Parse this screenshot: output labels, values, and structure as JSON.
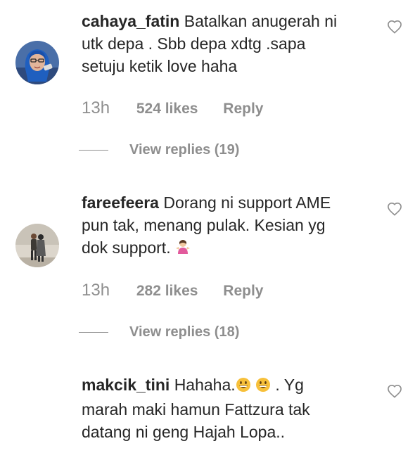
{
  "colors": {
    "text": "#262626",
    "muted": "#8e8e8e",
    "emoji_yellow": "#f7c03a"
  },
  "comments": [
    {
      "username": "cahaya_fatin",
      "text": "Batalkan anugerah ni\nutk depa . Sbb depa xdtg .sapa\nsetuju ketik love haha",
      "time": "13h",
      "likes": "524 likes",
      "reply": "Reply",
      "view_replies": "View replies (19)",
      "avatar_icon": "avatar-hijab-woman",
      "heart_icon": "heart-outline-icon"
    },
    {
      "username": "fareefeera",
      "text": "Dorang ni support AME\npun tak, menang pulak. Kesian yg\ndok support.",
      "emoji": "🤷‍♀️",
      "time": "13h",
      "likes": "282 likes",
      "reply": "Reply",
      "view_replies": "View replies (18)",
      "avatar_icon": "avatar-couple",
      "heart_icon": "heart-outline-icon"
    },
    {
      "username": "makcik_tini",
      "text_before_emoji": "Hahaha.",
      "text_line1_end": " . Yg",
      "text_rest": "marah maki hamun Fattzura tak\ndatang ni geng Hajah Lopa..",
      "heart_icon": "heart-outline-icon"
    }
  ]
}
